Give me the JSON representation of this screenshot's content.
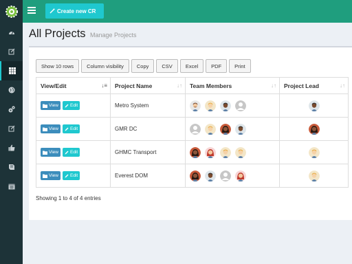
{
  "header": {
    "create_label": "Create new CR",
    "accent": "#1f9e7e",
    "button_color": "#1fc8cf"
  },
  "sidebar": {
    "items": [
      {
        "icon": "dashboard-icon"
      },
      {
        "icon": "edit-icon"
      },
      {
        "icon": "grid-icon",
        "active": true
      },
      {
        "icon": "globe-icon"
      },
      {
        "icon": "cogs-icon"
      },
      {
        "icon": "edit-icon"
      },
      {
        "icon": "thumbs-up-icon"
      },
      {
        "icon": "book-icon"
      },
      {
        "icon": "calendar-icon"
      }
    ]
  },
  "page": {
    "title": "All Projects",
    "subtitle": "Manage Projects"
  },
  "toolbar": {
    "buttons": [
      "Show 10 rows",
      "Column visibility",
      "Copy",
      "CSV",
      "Excel",
      "PDF",
      "Print"
    ]
  },
  "table": {
    "headers": [
      "View/Edit",
      "Project Name",
      "Team Members",
      "Project Lead"
    ],
    "view_label": "View",
    "edit_label": "Edit",
    "rows": [
      {
        "name": "Metro System",
        "members": [
          "man-beard",
          "man-blond",
          "man-dark",
          "placeholder"
        ],
        "lead": "man-dark"
      },
      {
        "name": "GMR DC",
        "members": [
          "placeholder",
          "man-blond",
          "woman-dark",
          "man-dark"
        ],
        "lead": "woman-dark"
      },
      {
        "name": "GHMC Transport",
        "members": [
          "woman-dark",
          "woman-red",
          "man-blond",
          "man-blond"
        ],
        "lead": "man-blond"
      },
      {
        "name": "Everest DOM",
        "members": [
          "woman-dark",
          "man-dark",
          "placeholder",
          "woman-red"
        ],
        "lead": "man-blond"
      }
    ]
  },
  "footer": {
    "info": "Showing 1 to 4 of 4 entries"
  }
}
